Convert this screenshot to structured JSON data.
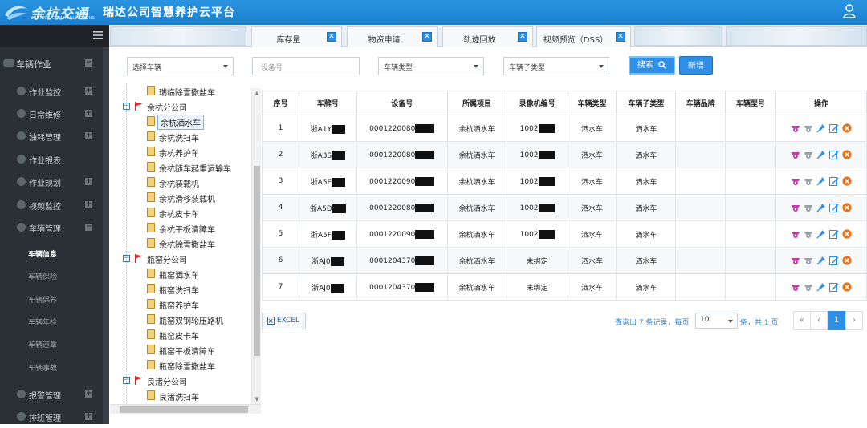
{
  "header": {
    "logo_text": "余杭交通",
    "logo_subtext": "YUHANG COMMUNICATIONS",
    "app_title": "瑞达公司智慧养护云平台"
  },
  "tabs": [
    {
      "label": "库存量"
    },
    {
      "label": "物资申请"
    },
    {
      "label": "轨迹回放"
    },
    {
      "label": "视频预览（DSS）"
    }
  ],
  "tab_close_symbol": "✕",
  "nav": {
    "section": "车辆作业",
    "items": [
      {
        "label": "作业监控"
      },
      {
        "label": "日常维修"
      },
      {
        "label": "油耗管理"
      },
      {
        "label": "作业报表"
      },
      {
        "label": "作业规划"
      },
      {
        "label": "视频监控"
      },
      {
        "label": "车辆管理"
      }
    ],
    "sub_items": [
      {
        "label": "车辆信息"
      },
      {
        "label": "车辆保险"
      },
      {
        "label": "车辆保养"
      },
      {
        "label": "车辆年检"
      },
      {
        "label": "车辆违章"
      },
      {
        "label": "车辆事故"
      }
    ],
    "bottom_items": [
      {
        "label": "报警管理"
      },
      {
        "label": "排班管理"
      }
    ]
  },
  "filters": {
    "vehicle_select": "选择车辆",
    "device_placeholder": "设备号",
    "type_select": "车辆类型",
    "subtype_select": "车辆子类型",
    "search_label": "搜索",
    "add_label": "新增"
  },
  "tree": {
    "top_leaf": "瑞临除雪撒盐车",
    "groups": [
      {
        "name": "余杭分公司",
        "children": [
          "余杭洒水车",
          "余杭洗扫车",
          "余杭养护车",
          "余杭随车起重运输车",
          "余杭装载机",
          "余杭滑移装载机",
          "余杭皮卡车",
          "余杭平板清障车",
          "余杭除雪撒盐车"
        ]
      },
      {
        "name": "瓶窑分公司",
        "children": [
          "瓶窑洒水车",
          "瓶窑洗扫车",
          "瓶窑养护车",
          "瓶窑双钢轮压路机",
          "瓶窑皮卡车",
          "瓶窑平板清障车",
          "瓶窑除雪撒盐车"
        ]
      },
      {
        "name": "良渚分公司",
        "children": [
          "良渚洗扫车"
        ]
      }
    ],
    "selected": "余杭洒水车"
  },
  "table": {
    "columns": [
      "序号",
      "车牌号",
      "设备号",
      "所属项目",
      "录像机编号",
      "车辆类型",
      "车辆子类型",
      "车辆品牌",
      "车辆型号",
      "操作"
    ],
    "rows": [
      {
        "no": "1",
        "plate": "浙A1Y",
        "device": "0001220080",
        "project": "余杭洒水车",
        "recorder": "1002",
        "type": "洒水车",
        "subtype": "洒水车",
        "brand": "",
        "model": ""
      },
      {
        "no": "2",
        "plate": "浙A3S",
        "device": "0001220080",
        "project": "余杭洒水车",
        "recorder": "1002",
        "type": "洒水车",
        "subtype": "洒水车",
        "brand": "",
        "model": ""
      },
      {
        "no": "3",
        "plate": "浙A5E",
        "device": "0001220090",
        "project": "余杭洒水车",
        "recorder": "1002",
        "type": "洒水车",
        "subtype": "洒水车",
        "brand": "",
        "model": ""
      },
      {
        "no": "4",
        "plate": "浙A5D",
        "device": "0001220080",
        "project": "余杭洒水车",
        "recorder": "1002",
        "type": "洒水车",
        "subtype": "洒水车",
        "brand": "",
        "model": ""
      },
      {
        "no": "5",
        "plate": "浙A5F",
        "device": "0001220090",
        "project": "余杭洒水车",
        "recorder": "1002",
        "type": "洒水车",
        "subtype": "洒水车",
        "brand": "",
        "model": ""
      },
      {
        "no": "6",
        "plate": "浙AJ0",
        "device": "0001204370",
        "project": "余杭洒水车",
        "recorder": "未绑定",
        "type": "洒水车",
        "subtype": "洒水车",
        "brand": "",
        "model": ""
      },
      {
        "no": "7",
        "plate": "浙AJ0",
        "device": "0001204370",
        "project": "余杭洒水车",
        "recorder": "未绑定",
        "type": "洒水车",
        "subtype": "洒水车",
        "brand": "",
        "model": ""
      }
    ],
    "row_actions": [
      "camera-icon",
      "camera-gray-icon",
      "pin-icon",
      "edit-icon",
      "delete-icon"
    ]
  },
  "footer": {
    "excel_label": "EXCEL",
    "summary_prefix": "查询出 7 条记录，每页",
    "page_size": "10",
    "summary_suffix": "条，共 1 页",
    "pager": {
      "first": "«",
      "prev": "‹",
      "current": "1",
      "next": "›"
    }
  },
  "colors": {
    "header_blue": "#1b7fd0",
    "accent": "#2f8ee5",
    "sidebar": "#2b3036",
    "delete_orange": "#e8731d"
  }
}
